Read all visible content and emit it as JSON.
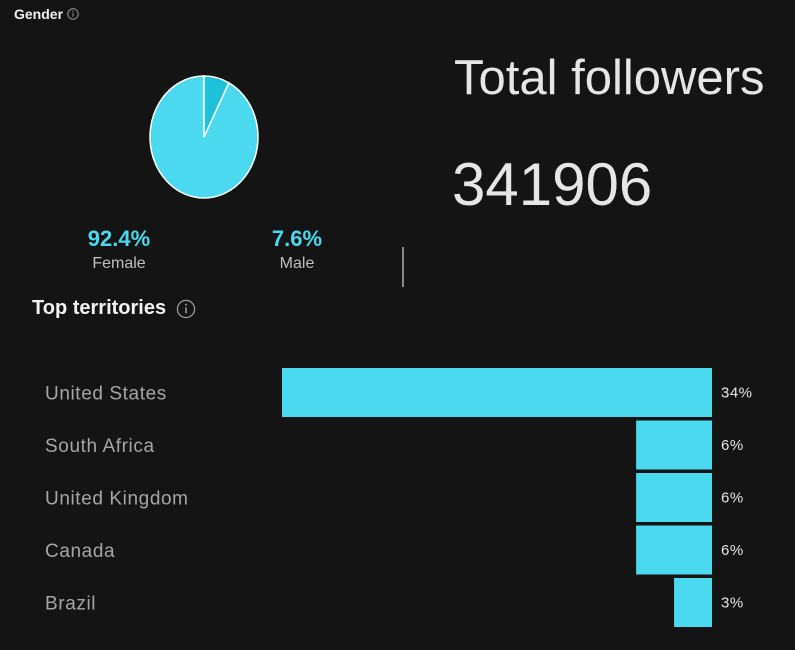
{
  "gender": {
    "title": "Gender",
    "female_pct": "92.4%",
    "female_label": "Female",
    "male_pct": "7.6%",
    "male_label": "Male",
    "slices": [
      {
        "name": "Female",
        "value": 92.4,
        "color": "#4ad9ee"
      },
      {
        "name": "Male",
        "value": 7.6,
        "color": "#1ec2d8"
      }
    ]
  },
  "followers": {
    "title": "Total followers",
    "value": "341906"
  },
  "territories": {
    "title": "Top territories"
  },
  "colors": {
    "accent": "#4ad9ee",
    "background": "#141414"
  },
  "chart_data": {
    "type": "bar",
    "orientation": "horizontal",
    "categories": [
      "United States",
      "South Africa",
      "United Kingdom",
      "Canada",
      "Brazil"
    ],
    "values": [
      34,
      6,
      6,
      6,
      3
    ],
    "value_labels": [
      "34%",
      "6%",
      "6%",
      "6%",
      "3%"
    ],
    "title": "Top territories",
    "xlabel": "",
    "ylabel": "",
    "xlim": [
      0,
      34
    ]
  }
}
